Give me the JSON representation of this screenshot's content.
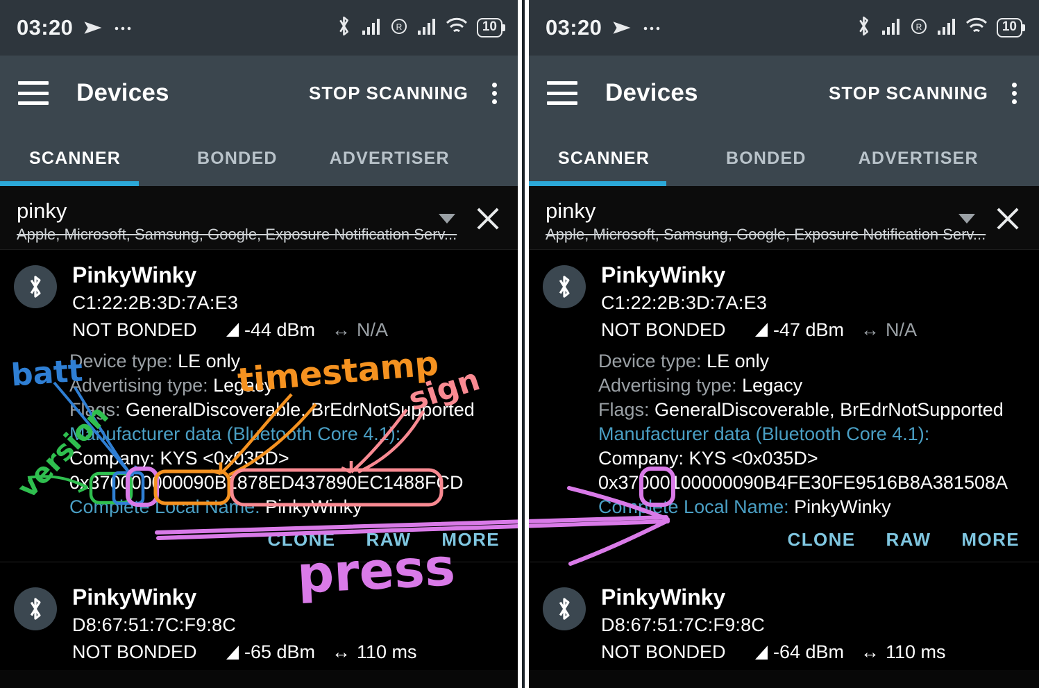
{
  "status_bar": {
    "time": "03:20",
    "left_icons": [
      "telegram-send-icon",
      "more-dots-icon"
    ],
    "right_icons": [
      "bluetooth-icon",
      "signal-bars-icon",
      "roaming-r-icon",
      "signal-bars-icon",
      "wifi-icon"
    ],
    "battery_level": "10"
  },
  "app_bar": {
    "menu_icon": "hamburger-menu-icon",
    "title": "Devices",
    "action_label": "STOP SCANNING",
    "overflow_icon": "overflow-menu-icon"
  },
  "tabs": [
    {
      "label": "SCANNER",
      "active": true
    },
    {
      "label": "BONDED",
      "active": false
    },
    {
      "label": "ADVERTISER",
      "active": false
    }
  ],
  "filter": {
    "value": "pinky",
    "subtitle": "Apple, Microsoft, Samsung, Google, Exposure Notification Serv...",
    "caret_icon": "chevron-down-icon",
    "clear_icon": "close-icon"
  },
  "panels": [
    {
      "id": "before",
      "devices": [
        {
          "icon": "bluetooth-icon",
          "name": "PinkyWinky",
          "address": "C1:22:2B:3D:7A:E3",
          "bond_state": "NOT BONDED",
          "rssi": "-44 dBm",
          "interval": "N/A",
          "interval_na": true,
          "expanded": true,
          "details": [
            {
              "label": "Device type:",
              "value": "LE only"
            },
            {
              "label": "Advertising type:",
              "value": "Legacy"
            },
            {
              "label": "Flags:",
              "value": "GeneralDiscoverable, BrEdrNotSupported"
            }
          ],
          "manufacturer_header": "Manufacturer data (Bluetooth Core 4.1):",
          "company": "Company: KYS <0x035D>",
          "hex": "0x370000000090B1878ED437890EC1488FCD",
          "local_name_key": "Complete Local Name:",
          "local_name_value": "PinkyWinky",
          "actions": [
            "CLONE",
            "RAW",
            "MORE"
          ]
        },
        {
          "icon": "bluetooth-icon",
          "name": "PinkyWinky",
          "address": "D8:67:51:7C:F9:8C",
          "bond_state": "NOT BONDED",
          "rssi": "-65 dBm",
          "interval": "110 ms",
          "interval_na": false,
          "expanded": false
        }
      ]
    },
    {
      "id": "after",
      "devices": [
        {
          "icon": "bluetooth-icon",
          "name": "PinkyWinky",
          "address": "C1:22:2B:3D:7A:E3",
          "bond_state": "NOT BONDED",
          "rssi": "-47 dBm",
          "interval": "N/A",
          "interval_na": true,
          "expanded": true,
          "details": [
            {
              "label": "Device type:",
              "value": "LE only"
            },
            {
              "label": "Advertising type:",
              "value": "Legacy"
            },
            {
              "label": "Flags:",
              "value": "GeneralDiscoverable, BrEdrNotSupported"
            }
          ],
          "manufacturer_header": "Manufacturer data (Bluetooth Core 4.1):",
          "company": "Company: KYS <0x035D>",
          "hex": "0x37000100000090B4FE30FE9516B8A381508A",
          "local_name_key": "Complete Local Name:",
          "local_name_value": "PinkyWinky",
          "actions": [
            "CLONE",
            "RAW",
            "MORE"
          ]
        },
        {
          "icon": "bluetooth-icon",
          "name": "PinkyWinky",
          "address": "D8:67:51:7C:F9:8C",
          "bond_state": "NOT BONDED",
          "rssi": "-64 dBm",
          "interval": "110 ms",
          "interval_na": false,
          "expanded": false
        }
      ]
    }
  ],
  "annotations": [
    {
      "id": "batt",
      "text": "batt",
      "color": "#2f7fd4"
    },
    {
      "id": "version",
      "text": "version",
      "color": "#2fbf4f"
    },
    {
      "id": "timestamp",
      "text": "timestamp",
      "color": "#f59220"
    },
    {
      "id": "sign",
      "text": "sign",
      "color": "#f98a92"
    },
    {
      "id": "press",
      "text": "press",
      "color": "#d97ae8"
    }
  ],
  "annotation_colors": {
    "batt": "#2f7fd4",
    "version": "#2fbf4f",
    "timestamp": "#f59220",
    "sign": "#f98a92",
    "press": "#d97ae8",
    "highlight_box": "#d97ae8"
  }
}
